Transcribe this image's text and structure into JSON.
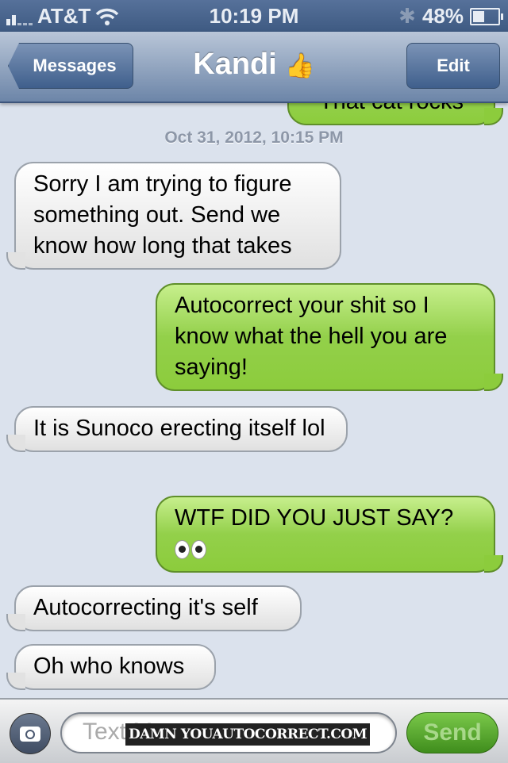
{
  "status_bar": {
    "carrier": "AT&T",
    "time": "10:19 PM",
    "battery": "48%",
    "battery_level": 0.48,
    "icons": [
      "signal-icon",
      "wifi-icon",
      "bluetooth-icon",
      "battery-icon"
    ]
  },
  "nav": {
    "back_label": "Messages",
    "title": "Kandi",
    "title_emoji": "👍",
    "edit_label": "Edit"
  },
  "thread": {
    "cropped_message": "That cat rocks",
    "timestamp": "Oct 31, 2012, 10:15 PM",
    "messages": [
      {
        "from": "them",
        "text": "Sorry I am trying to figure something out. Send we know how long that takes"
      },
      {
        "from": "me",
        "text": "Autocorrect your shit so I know what the hell you are saying!"
      },
      {
        "from": "them",
        "text": "It is Sunoco erecting itself lol"
      },
      {
        "from": "me",
        "text": "WTF DID YOU JUST SAY?",
        "emoji": "eyes"
      },
      {
        "from": "them",
        "text": "Autocorrecting it's self"
      },
      {
        "from": "them",
        "text": "Oh who knows"
      }
    ]
  },
  "composer": {
    "placeholder": "Text Message",
    "send_label": "Send"
  },
  "watermark": "DAMN YOUAUTOCORRECT.COM",
  "colors": {
    "outgoing_bubble": "#8ccc3c",
    "incoming_bubble": "#e6e6e6",
    "nav_bar": "#6c85a8",
    "background": "#dbe2ed"
  }
}
